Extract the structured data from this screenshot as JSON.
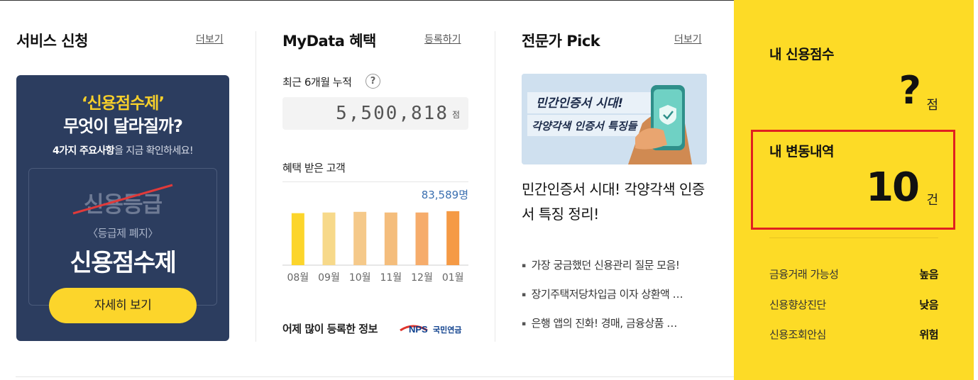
{
  "service": {
    "title": "서비스 신청",
    "more_label": "더보기",
    "banner": {
      "quote_line": "‘신용점수제’",
      "question_line": "무엇이 달라질까?",
      "sub_bold": "4가지 주요사항",
      "sub_rest": "을 지금 확인하세요!",
      "old_term": "신용등급",
      "paren_text": "〈등급제 폐지〉",
      "new_term": "신용점수제",
      "button_label": "자세히 보기"
    }
  },
  "mydata": {
    "title": "MyData 혜택",
    "register_label": "등록하기",
    "cumulative_label": "최근 6개월 누적",
    "help_icon": "question-icon",
    "cumulative_value": "5,500,818",
    "cumulative_unit": "점",
    "customers_label": "혜택 받은 고객",
    "customers_value": "83,589명",
    "bottom_label": "어제 많이 등록한 정보",
    "logo_text": "NPS 국민연금",
    "logo_nps": "NPS",
    "logo_kr": "국민연금"
  },
  "chart_data": {
    "type": "bar",
    "categories": [
      "08월",
      "09월",
      "10월",
      "11월",
      "12월",
      "01월"
    ],
    "values": [
      78,
      79,
      80,
      79,
      79,
      81
    ],
    "colors": [
      "#fcd52b",
      "#f7d98a",
      "#f5c98a",
      "#f4bd7c",
      "#f6ac6b",
      "#f59a45"
    ],
    "ylim": [
      0,
      100
    ],
    "last_label": "83,589명"
  },
  "expert": {
    "title": "전문가 Pick",
    "more_label": "더보기",
    "image_text_line1": "민간인증서 시대!",
    "image_text_line2": "각양각색 인증서 특징들",
    "headline": "민간인증서 시대! 각양각색 인증서 특징 정리!",
    "items": [
      "가장 궁금했던 신용관리 질문 모음!",
      "장기주택저당차입금 이자 상환액 …",
      "은행 앱의 진화! 경매, 금융상품 …"
    ]
  },
  "credit": {
    "score_title": "내 신용점수",
    "score_value": "?",
    "score_unit": "점",
    "changes_title": "내 변동내역",
    "changes_value": "10",
    "changes_unit": "건",
    "rows": [
      {
        "label": "금융거래 가능성",
        "value": "높음"
      },
      {
        "label": "신용향상진단",
        "value": "낮음"
      },
      {
        "label": "신용조회안심",
        "value": "위험"
      }
    ],
    "accent": "#fddb26",
    "highlight": "#e02020"
  }
}
